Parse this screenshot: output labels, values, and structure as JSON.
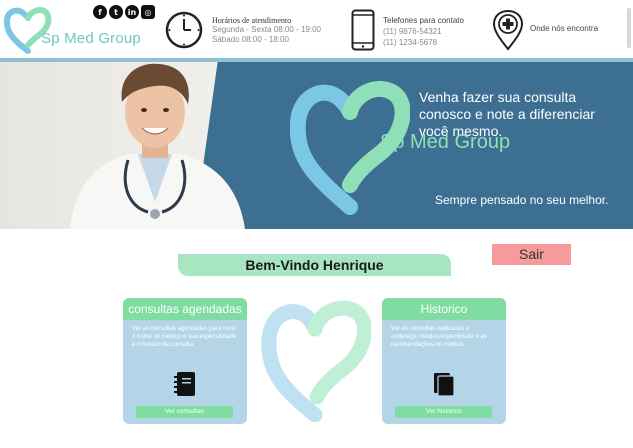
{
  "header": {
    "brand": "Sp Med Group",
    "socials": [
      {
        "name": "facebook",
        "glyph": "f"
      },
      {
        "name": "twitter",
        "glyph": "t"
      },
      {
        "name": "linkedin",
        "glyph": "in"
      },
      {
        "name": "instagram",
        "glyph": "◎"
      }
    ],
    "hours_title": "Horários de atendimento",
    "hours_lines": [
      "Segunda - Sexta 08:00 - 19:00",
      "Sábado 08:00 - 18:00"
    ],
    "phones_title": "Telefones para contato",
    "phones": [
      "(11) 9876-54321",
      "(11) 1234-5678"
    ],
    "location": "Onde nós encontra"
  },
  "banner": {
    "message": "Venha fazer sua consulta conosco e note a diferenciar você mesmo.",
    "brand": "Sp Med Group",
    "slogan": "Sempre pensado no seu melhor."
  },
  "welcome": "Bem-Vindo Henrique",
  "logout_label": "Sair",
  "cards": [
    {
      "title": "consultas agendadas",
      "description": "Ver as consultas agendadas para você o nome do médico e sua especialidade e o horário da consulta.",
      "button": "Ver consultas",
      "icon": "notebook-icon"
    },
    {
      "title": "Historico",
      "description": "Ver as consultas realizadas o endereço, médico,especilidade e as recomendações do médico.",
      "button": "Ver historico",
      "icon": "files-icon"
    }
  ],
  "colors": {
    "accent_green": "#80dda2",
    "accent_blue": "#b4d4e8",
    "banner_blue": "#3d6f92",
    "logout": "#f59b9b"
  }
}
